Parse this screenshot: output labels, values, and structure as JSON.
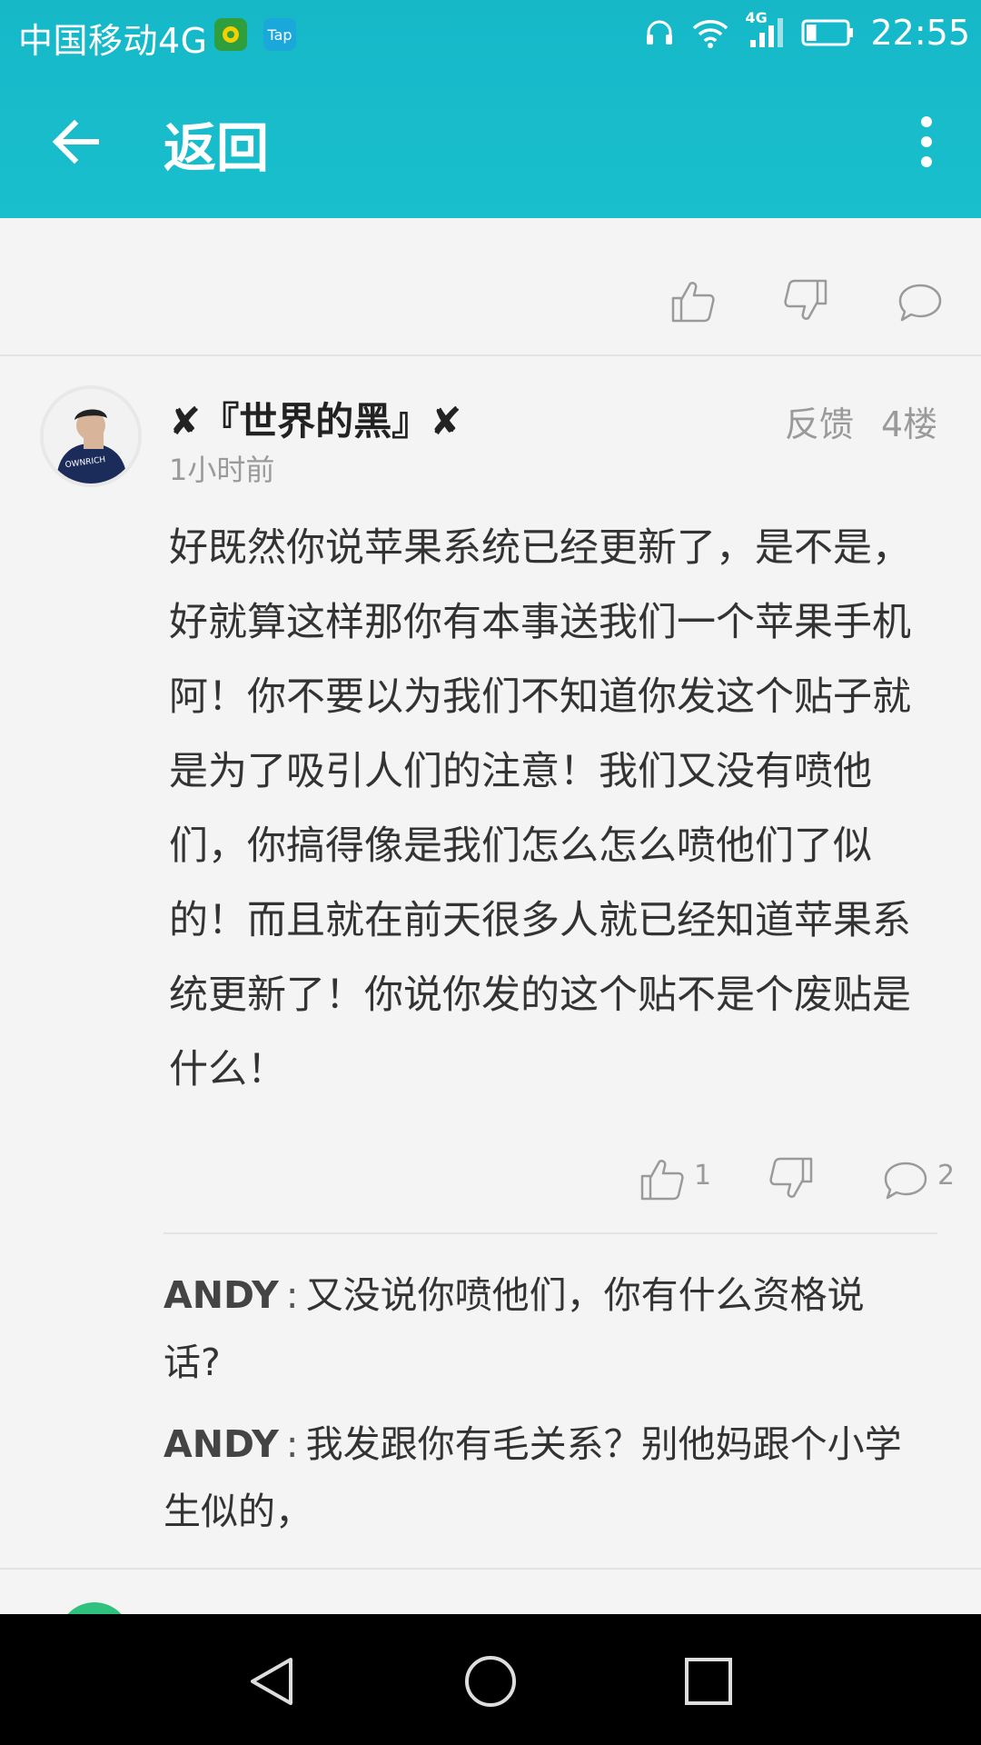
{
  "status_bar": {
    "carrier": "中国移动4G",
    "network_badge": "4G",
    "tap_icon_label": "Tap",
    "time": "22:55",
    "battery_level": 0.25
  },
  "header": {
    "back_label": "返回"
  },
  "comment": {
    "username": "✘『世界的黑』✘",
    "time_ago": "1小时前",
    "feedback_label": "反馈",
    "floor_label": "4楼",
    "avatar_text": "OWNRICH",
    "body": "好既然你说苹果系统已经更新了，是不是，好就算这样那你有本事送我们一个苹果手机阿！你不要以为我们不知道你发这个贴子就是为了吸引人们的注意！我们又没有喷他们，你搞得像是我们怎么怎么喷他们了似的！而且就在前天很多人就已经知道苹果系统更新了！你说你发的这个贴不是个废贴是什么！",
    "like_count": "1",
    "comment_count": "2",
    "replies": [
      {
        "author": "ANDY",
        "separator": ":",
        "text": "又没说你喷他们，你有什么资格说话?"
      },
      {
        "author": "ANDY",
        "separator": ":",
        "text": "我发跟你有毛关系？别他妈跟个小学生似的，"
      }
    ]
  },
  "icons": {
    "back": "arrow-left-icon",
    "more": "more-vertical-icon",
    "like": "thumbs-up-icon",
    "dislike": "thumbs-down-icon",
    "comment": "speech-bubble-icon",
    "nav_back": "triangle-back-icon",
    "nav_home": "circle-home-icon",
    "nav_recent": "square-recent-icon"
  },
  "colors": {
    "app_bar": "#19bfcd",
    "background": "#f4f4f4",
    "muted_text": "#9a9a9a"
  }
}
